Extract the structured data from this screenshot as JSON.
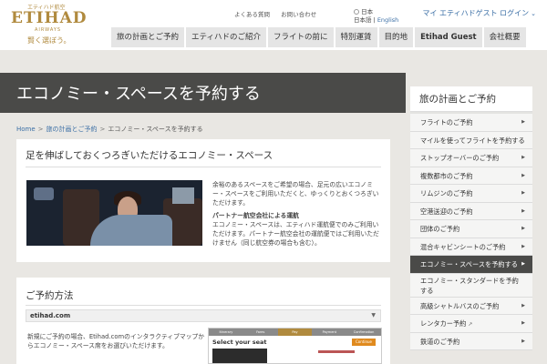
{
  "logo": {
    "kana": "エティハド航空",
    "brand": "ETIHAD",
    "sub": "AIRWAYS",
    "tagline": "賢く選ぼう。"
  },
  "util_links": [
    "よくある質問",
    "お問い合わせ"
  ],
  "language": {
    "current": "日本",
    "options": [
      "日本語",
      "English"
    ]
  },
  "login": "マイ エティハドゲスト ログイン",
  "nav": [
    {
      "label": "旅の計画とご予約",
      "bold": false
    },
    {
      "label": "エティハドのご紹介",
      "bold": false
    },
    {
      "label": "フライトの前に",
      "bold": false
    },
    {
      "label": "特別運賃",
      "bold": false
    },
    {
      "label": "目的地",
      "bold": false
    },
    {
      "label": "Etihad Guest",
      "bold": true
    },
    {
      "label": "会社概要",
      "bold": false
    }
  ],
  "hero_title": "エコノミー・スペースを予約する",
  "breadcrumb": {
    "home": "Home",
    "parent": "旅の計画とご予約",
    "current": "エコノミー・スペースを予約する",
    "sep": ">"
  },
  "section1": {
    "title": "足を伸ばしておくつろぎいただけるエコノミー・スペース",
    "paragraph": "余裕のあるスペースをご希望の場合、足元の広いエコノミー・スペースをご利用いただくと、ゆっくりとおくつろぎいただけます。",
    "partner_title": "パートナー航空会社による運航",
    "partner_text": "エコノミー・スペースは、エティハド運航便でのみご利用いただけます。パートナー航空会社の運航便ではご利用いただけません（同じ航空券の場合も含む）。"
  },
  "section2": {
    "title": "ご予約方法",
    "dropdown": "etihad.com",
    "text": "新規にご予約の場合、Etihad.comのインタラクティブマップからエコノミー・スペース席をお選びいただけます。",
    "booking": {
      "steps": [
        "Itinerary",
        "Fares",
        "Pay",
        "Payment",
        "Confirmation"
      ],
      "title": "Select your seat",
      "continue": "Continue"
    }
  },
  "sidebar": {
    "title": "旅の計画とご予約",
    "items": [
      {
        "label": "フライトのご予約",
        "arrow": "▶",
        "active": false,
        "ext": ""
      },
      {
        "label": "マイルを使ってフライトを予約する",
        "arrow": "",
        "active": false,
        "ext": ""
      },
      {
        "label": "ストップオーバーのご予約",
        "arrow": "▶",
        "active": false,
        "ext": ""
      },
      {
        "label": "複数都市のご予約",
        "arrow": "▶",
        "active": false,
        "ext": ""
      },
      {
        "label": "リムジンのご予約",
        "arrow": "▶",
        "active": false,
        "ext": ""
      },
      {
        "label": "空港送迎のご予約",
        "arrow": "▶",
        "active": false,
        "ext": ""
      },
      {
        "label": "団体のご予約",
        "arrow": "▶",
        "active": false,
        "ext": ""
      },
      {
        "label": "混合キャビンシートのご予約",
        "arrow": "▶",
        "active": false,
        "ext": ""
      },
      {
        "label": "エコノミー・スペースを予約する",
        "arrow": "▶",
        "active": true,
        "ext": ""
      },
      {
        "label": "エコノミー・スタンダードを予約する",
        "arrow": "",
        "active": false,
        "ext": "",
        "tall": true
      },
      {
        "label": "高級シャトルバスのご予約",
        "arrow": "▶",
        "active": false,
        "ext": ""
      },
      {
        "label": "レンタカー予約",
        "arrow": "▶",
        "active": false,
        "ext": "↗"
      },
      {
        "label": "鉄道のご予約",
        "arrow": "▶",
        "active": false,
        "ext": ""
      }
    ]
  }
}
